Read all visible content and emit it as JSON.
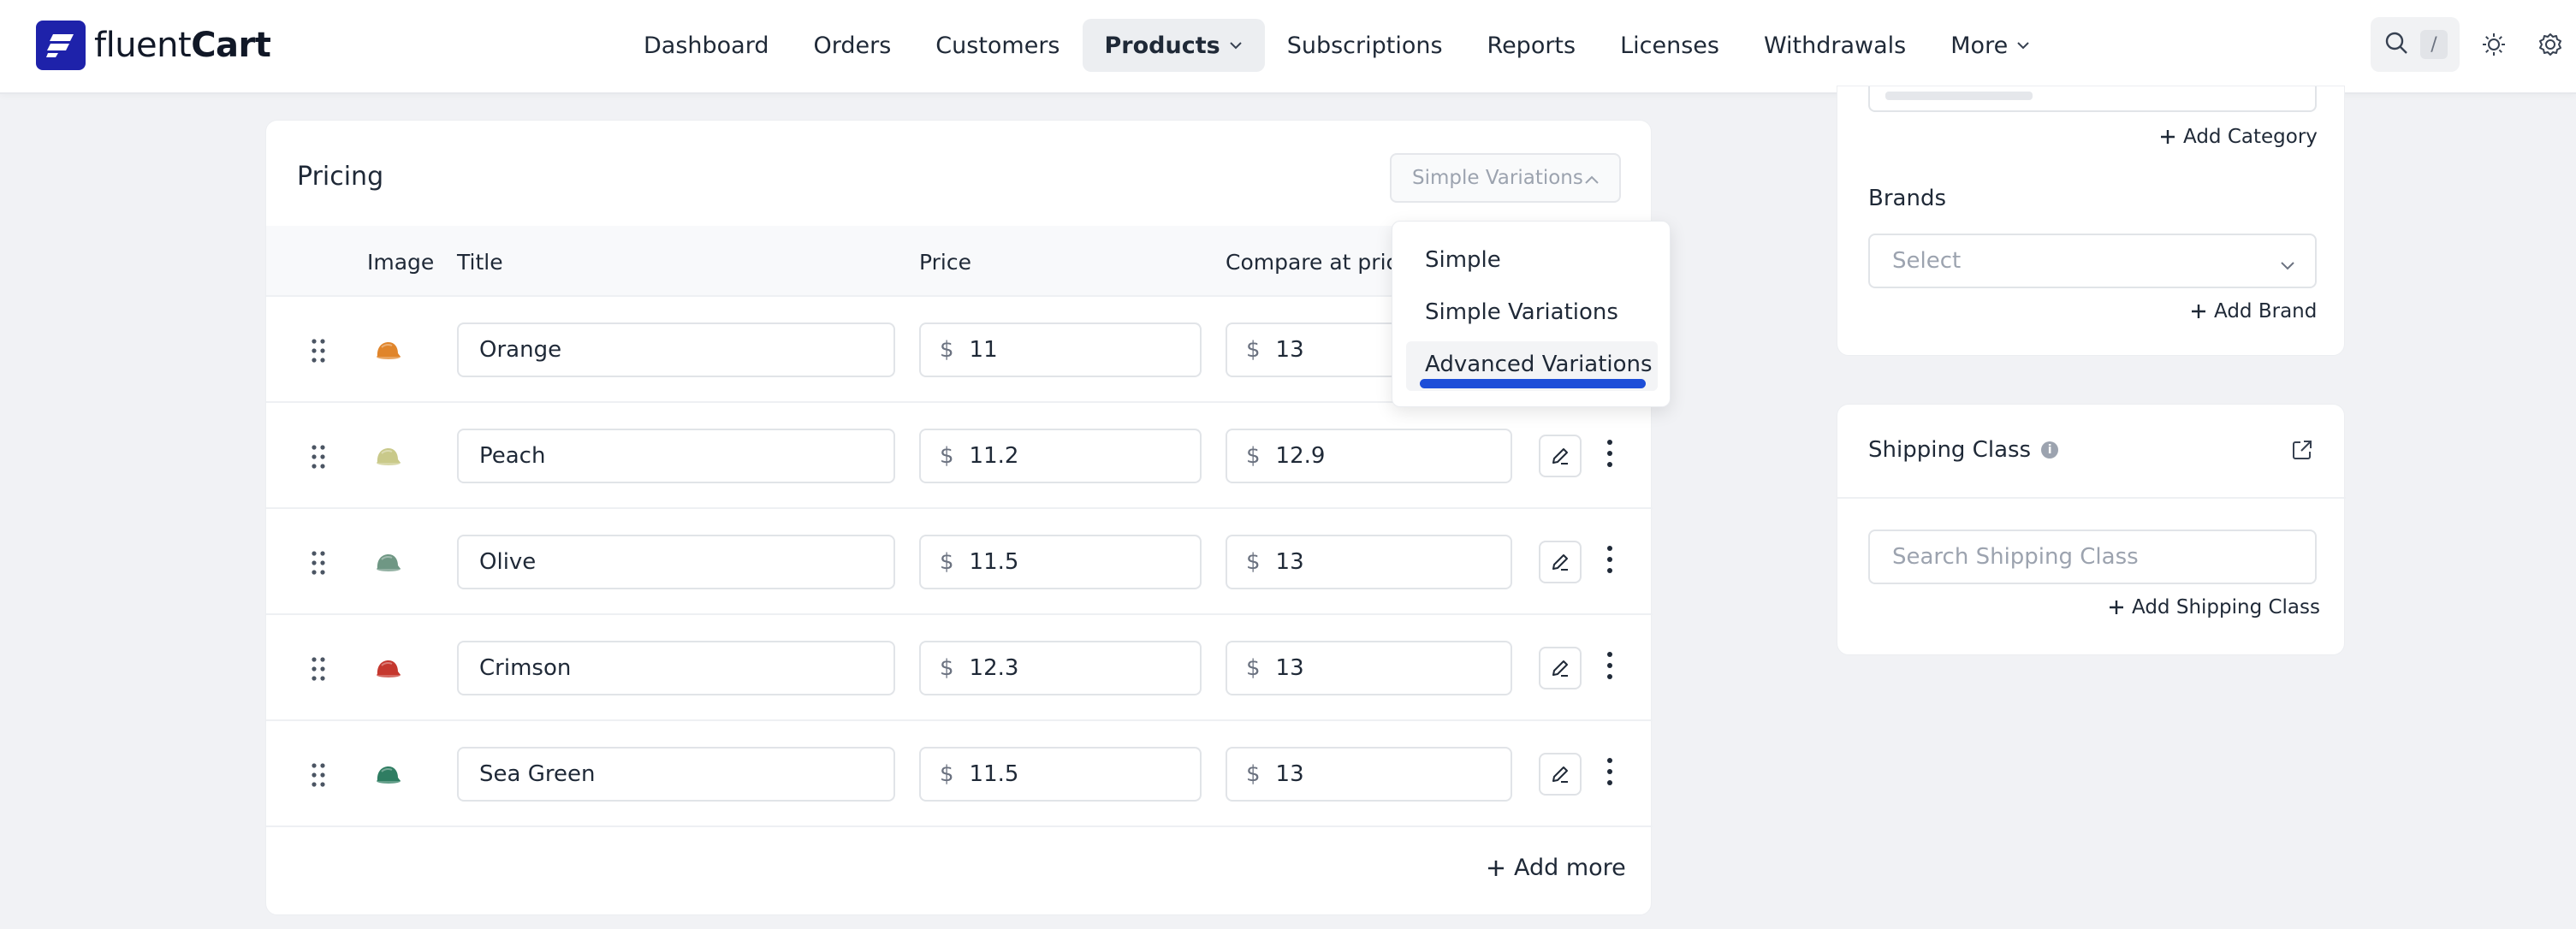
{
  "brand": {
    "name_light": "fluent",
    "name_bold": "Cart"
  },
  "nav": {
    "items": [
      "Dashboard",
      "Orders",
      "Customers",
      "Products",
      "Subscriptions",
      "Reports",
      "Licenses",
      "Withdrawals",
      "More"
    ],
    "active": "Products",
    "search_shortcut": "/"
  },
  "pricing": {
    "title": "Pricing",
    "variation_type": "Simple Variations",
    "columns": [
      "Image",
      "Title",
      "Price",
      "Compare at pric"
    ],
    "currency": "$",
    "rows": [
      {
        "title": "Orange",
        "price": "11",
        "compare": "13",
        "color": "#e0852b"
      },
      {
        "title": "Peach",
        "price": "11.2",
        "compare": "12.9",
        "color": "#c9c98a"
      },
      {
        "title": "Olive",
        "price": "11.5",
        "compare": "13",
        "color": "#6f9784"
      },
      {
        "title": "Crimson",
        "price": "12.3",
        "compare": "13",
        "color": "#c5382f"
      },
      {
        "title": "Sea Green",
        "price": "11.5",
        "compare": "13",
        "color": "#2f7d62"
      }
    ],
    "add_more": "Add more",
    "dropdown": {
      "options": [
        "Simple",
        "Simple Variations",
        "Advanced Variations"
      ],
      "hovered": "Advanced Variations"
    }
  },
  "sidebar": {
    "add_category": "Add Category",
    "brands_label": "Brands",
    "brands_placeholder": "Select",
    "add_brand": "Add Brand",
    "shipping_title": "Shipping Class",
    "shipping_placeholder": "Search Shipping Class",
    "add_shipping": "Add Shipping Class"
  },
  "colors": {
    "brand": "#1e22aa",
    "highlight": "#1d4ed8"
  }
}
